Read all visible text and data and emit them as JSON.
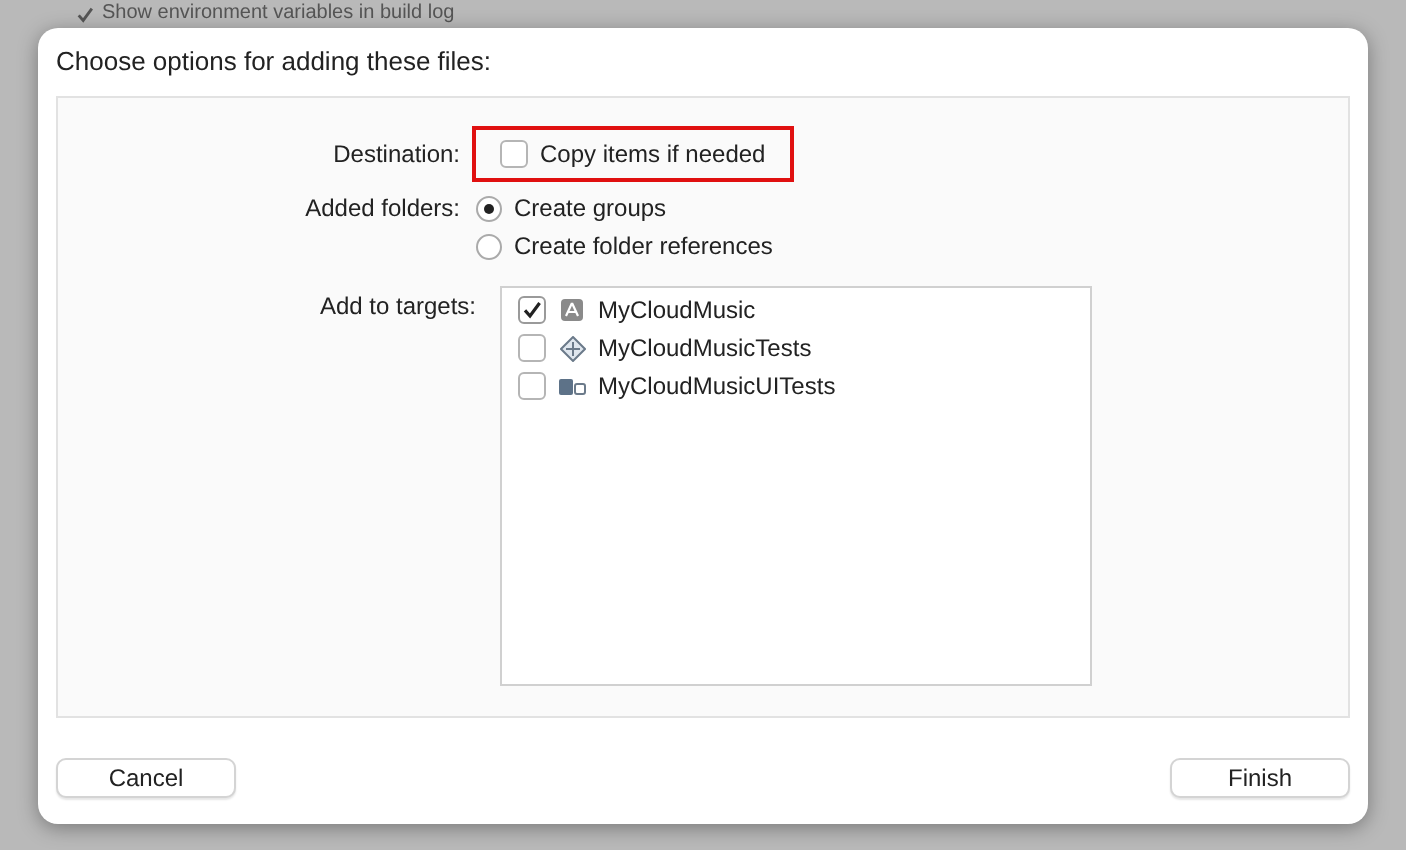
{
  "background": {
    "option": {
      "label": "Show environment variables in build log",
      "checked": true
    }
  },
  "dialog": {
    "title": "Choose options for adding these files:",
    "destination": {
      "label": "Destination:",
      "option": {
        "label": "Copy items if needed",
        "checked": false,
        "highlighted": true
      }
    },
    "added_folders": {
      "label": "Added folders:",
      "options": [
        {
          "label": "Create groups",
          "selected": true
        },
        {
          "label": "Create folder references",
          "selected": false
        }
      ]
    },
    "targets": {
      "label": "Add to targets:",
      "items": [
        {
          "name": "MyCloudMusic",
          "kind": "app",
          "checked": true
        },
        {
          "name": "MyCloudMusicTests",
          "kind": "unit-tests",
          "checked": false
        },
        {
          "name": "MyCloudMusicUITests",
          "kind": "ui-tests",
          "checked": false
        }
      ]
    },
    "buttons": {
      "cancel": "Cancel",
      "finish": "Finish"
    }
  }
}
